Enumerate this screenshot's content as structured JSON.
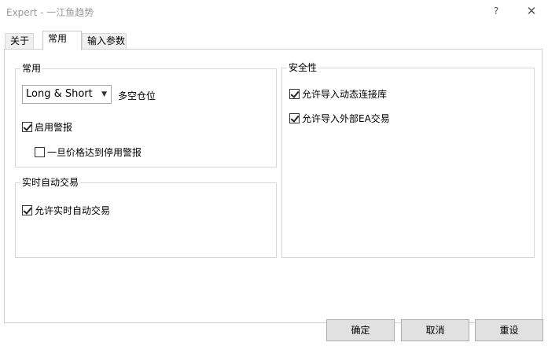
{
  "window": {
    "title": "Expert - 一江鱼趋势",
    "help_label": "?",
    "close_label": "✕"
  },
  "tabs": [
    {
      "label": "关于",
      "active": false
    },
    {
      "label": "常用",
      "active": true
    },
    {
      "label": "输入参数",
      "active": false
    }
  ],
  "common_group": {
    "title": "常用",
    "position_mode": {
      "value": "Long & Short",
      "label": "多空仓位"
    },
    "enable_alerts": {
      "label": "启用警报",
      "checked": true
    },
    "disable_alert_on_price": {
      "label": "一旦价格达到停用警报",
      "checked": false
    }
  },
  "auto_trading_group": {
    "title": "实时自动交易",
    "allow_live_trading": {
      "label": "允许实时自动交易",
      "checked": true
    }
  },
  "security_group": {
    "title": "安全性",
    "allow_dll_import": {
      "label": "允许导入动态连接库",
      "checked": true
    },
    "allow_external_ea": {
      "label": "允许导入外部EA交易",
      "checked": true
    }
  },
  "buttons": {
    "ok": "确定",
    "cancel": "取消",
    "reset": "重设"
  }
}
